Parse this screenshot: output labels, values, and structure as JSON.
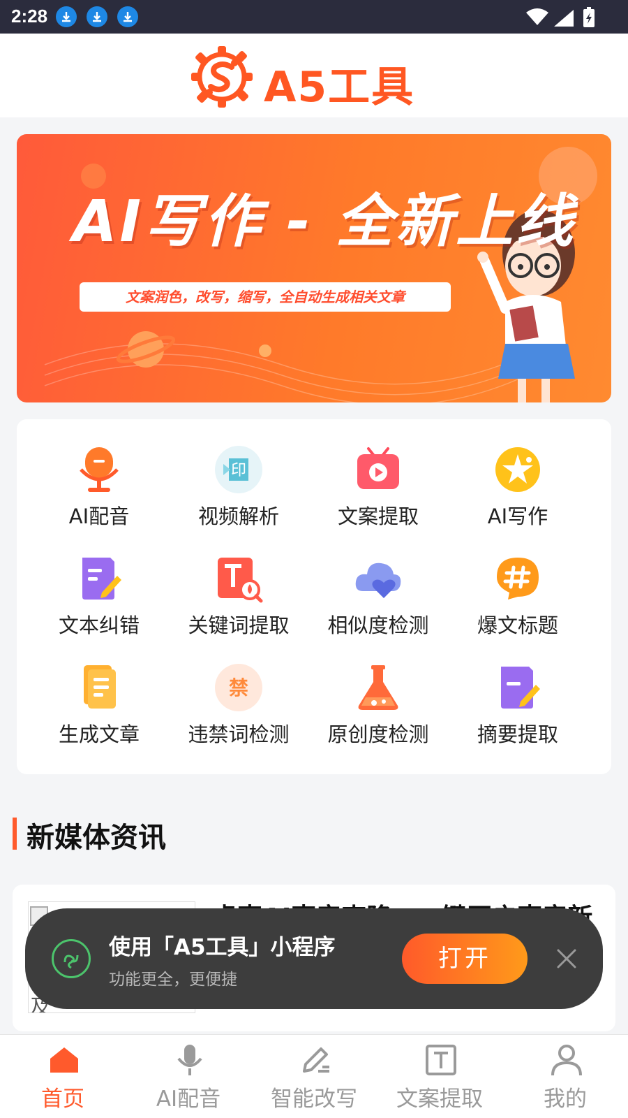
{
  "status_bar": {
    "time": "2:28"
  },
  "header": {
    "brand": "A5工具"
  },
  "banner": {
    "headline": "AI写作 - 全新上线",
    "subline": "文案润色，改写，缩写，全自动生成相关文章"
  },
  "tools": [
    {
      "label": "AI配音",
      "icon": "microphone-icon"
    },
    {
      "label": "视频解析",
      "icon": "video-parse-icon"
    },
    {
      "label": "文案提取",
      "icon": "tv-play-icon"
    },
    {
      "label": "AI写作",
      "icon": "star-icon"
    },
    {
      "label": "文本纠错",
      "icon": "doc-edit-icon"
    },
    {
      "label": "关键词提取",
      "icon": "keyword-search-icon"
    },
    {
      "label": "相似度检测",
      "icon": "heart-cloud-icon"
    },
    {
      "label": "爆文标题",
      "icon": "hashtag-icon"
    },
    {
      "label": "生成文章",
      "icon": "document-icon"
    },
    {
      "label": "违禁词检测",
      "icon": "forbidden-icon"
    },
    {
      "label": "原创度检测",
      "icon": "flask-icon"
    },
    {
      "label": "摘要提取",
      "icon": "doc-pen-icon"
    }
  ],
  "news": {
    "section_title": "新媒体资讯",
    "item": {
      "image_alt": "虚声AI声音克",
      "image_alt_tail": "及",
      "title": "虚声AI声音克隆：一键开启声音新"
    }
  },
  "popup": {
    "title": "使用「A5工具」小程序",
    "subtitle": "功能更全，更便捷",
    "open_label": "打开"
  },
  "tabbar": [
    {
      "label": "首页",
      "icon": "home-icon",
      "active": true
    },
    {
      "label": "AI配音",
      "icon": "microphone-icon",
      "active": false
    },
    {
      "label": "智能改写",
      "icon": "pen-icon",
      "active": false
    },
    {
      "label": "文案提取",
      "icon": "text-box-icon",
      "active": false
    },
    {
      "label": "我的",
      "icon": "user-icon",
      "active": false
    }
  ],
  "colors": {
    "accent": "#ff5a2c",
    "popup_bg": "#3d3d3d",
    "status_bar": "#2b2c3d"
  }
}
